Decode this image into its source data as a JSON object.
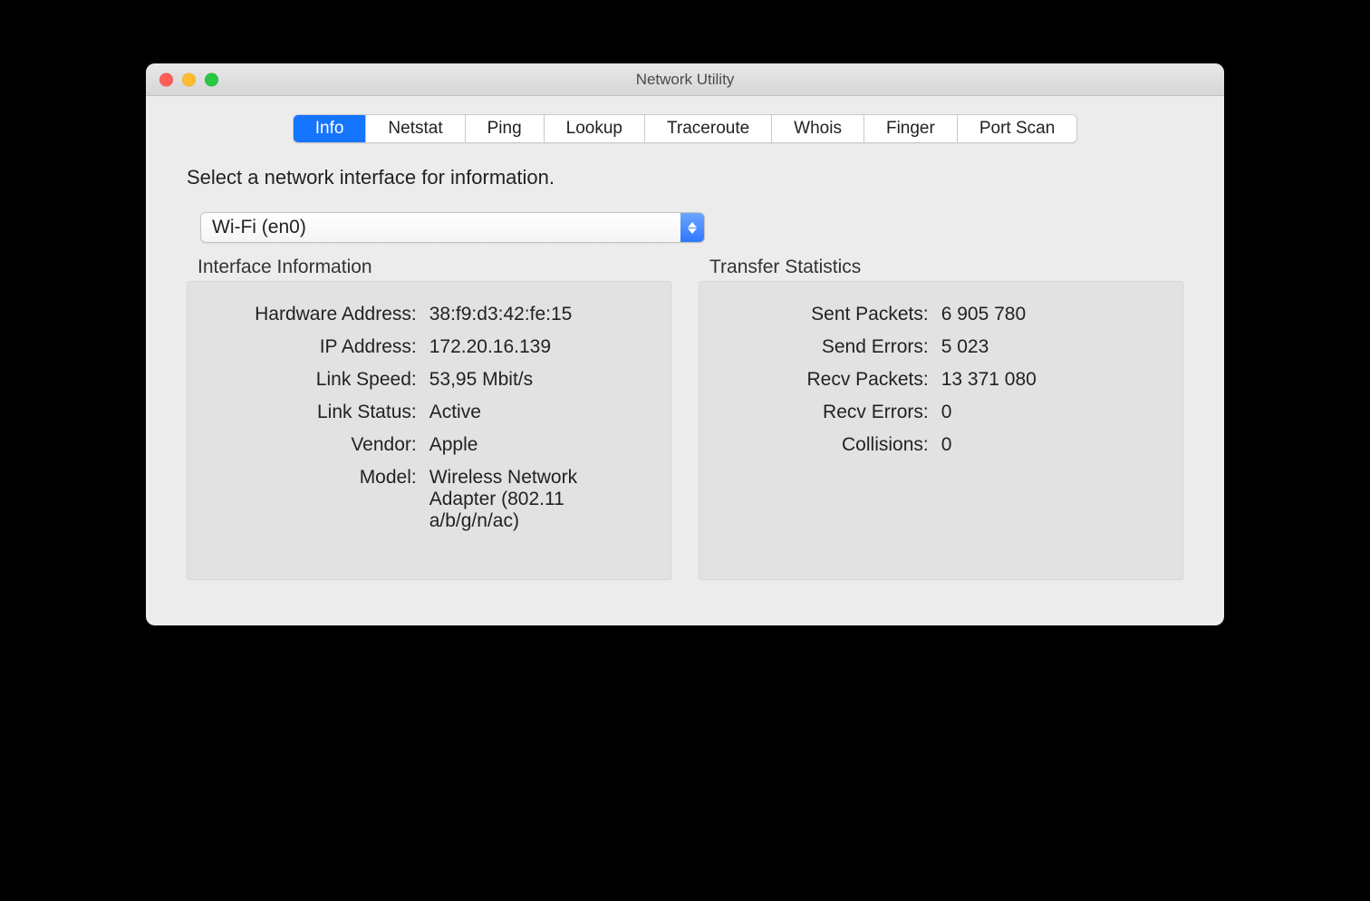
{
  "window_title": "Network Utility",
  "tabs": [
    "Info",
    "Netstat",
    "Ping",
    "Lookup",
    "Traceroute",
    "Whois",
    "Finger",
    "Port Scan"
  ],
  "active_tab": 0,
  "prompt": "Select a network interface for information.",
  "select_value": "Wi-Fi (en0)",
  "left_legend": "Interface Information",
  "right_legend": "Transfer Statistics",
  "interface_info": {
    "hardware_address_label": "Hardware Address:",
    "hardware_address": "38:f9:d3:42:fe:15",
    "ip_address_label": "IP Address:",
    "ip_address": "172.20.16.139",
    "link_speed_label": "Link Speed:",
    "link_speed": "53,95 Mbit/s",
    "link_status_label": "Link Status:",
    "link_status": "Active",
    "vendor_label": "Vendor:",
    "vendor": "Apple",
    "model_label": "Model:",
    "model": "Wireless Network Adapter (802.11 a/b/g/n/ac)"
  },
  "transfer_stats": {
    "sent_packets_label": "Sent Packets:",
    "sent_packets": "6 905 780",
    "send_errors_label": "Send Errors:",
    "send_errors": "5 023",
    "recv_packets_label": "Recv Packets:",
    "recv_packets": "13 371 080",
    "recv_errors_label": "Recv Errors:",
    "recv_errors": "0",
    "collisions_label": "Collisions:",
    "collisions": "0"
  }
}
